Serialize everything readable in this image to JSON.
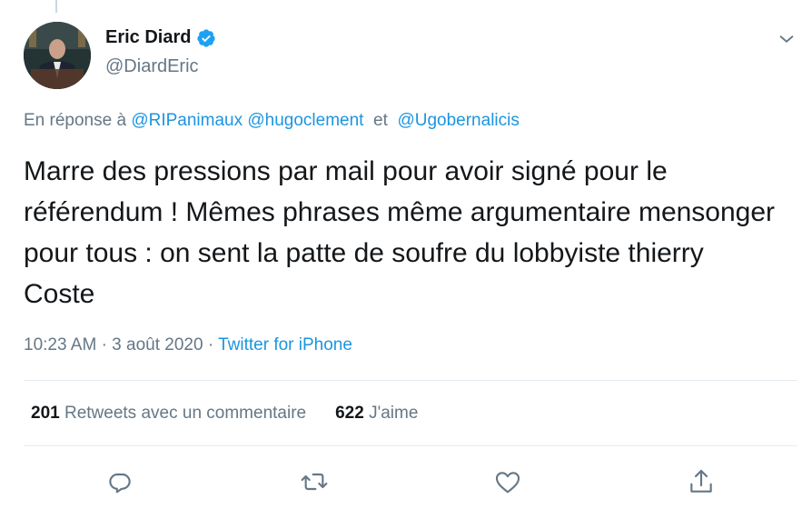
{
  "author": {
    "display_name": "Eric Diard",
    "handle": "@DiardEric"
  },
  "reply": {
    "prefix": "En réponse à",
    "mention_1": "@RIPanimaux",
    "mention_2": "@hugoclement",
    "conjunction": "et",
    "mention_3": "@Ugobernalicis"
  },
  "tweet": {
    "text": "Marre des pressions par mail pour avoir signé pour le référendum ! Mêmes phrases même argumentaire mensonger pour tous : on sent la patte de soufre du lobbyiste thierry Coste"
  },
  "meta": {
    "time": "10:23 AM",
    "separator": "·",
    "date": "3 août 2020",
    "source": "Twitter for iPhone"
  },
  "stats": {
    "retweets_count": "201",
    "retweets_label": "Retweets avec un commentaire",
    "likes_count": "622",
    "likes_label": "J'aime"
  },
  "icons": {
    "verified": "verified-badge-icon",
    "menu": "chevron-down-icon",
    "reply": "reply-icon",
    "retweet": "retweet-icon",
    "like": "heart-icon",
    "share": "share-icon"
  },
  "colors": {
    "link": "#1b95e0",
    "secondary_text": "#657786",
    "primary_text": "#14171a",
    "verified": "#1da1f2"
  }
}
